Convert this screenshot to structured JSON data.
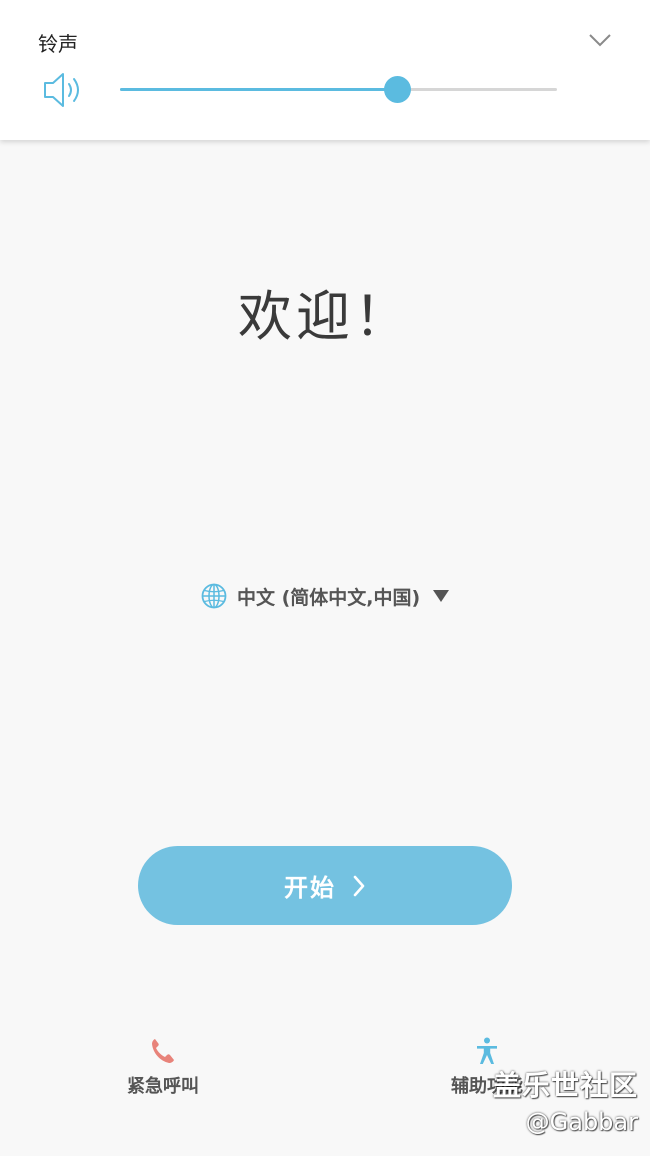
{
  "volume_panel": {
    "title": "铃声",
    "level": 0.634,
    "accent_color": "#5bbbe0",
    "icons": {
      "speaker": "speaker-icon",
      "collapse": "chevron-down-icon"
    }
  },
  "welcome": {
    "text": "欢迎！"
  },
  "language": {
    "label": "中文 (简体中文,中国)",
    "icons": {
      "globe": "globe-icon",
      "dropdown": "triangle-down-icon"
    }
  },
  "start_button": {
    "label": "开始",
    "color": "#74c2e1",
    "icons": {
      "chevron": "chevron-right-icon"
    }
  },
  "bottom_actions": {
    "emergency": {
      "label": "紧急呼叫",
      "icon": "phone-icon",
      "icon_color": "#e8837a"
    },
    "accessibility": {
      "label": "辅助功能",
      "icon": "accessibility-icon",
      "icon_color": "#5bbbe0"
    }
  },
  "watermark": {
    "line1": "盖乐世社区",
    "line2": "@Gabbar"
  }
}
